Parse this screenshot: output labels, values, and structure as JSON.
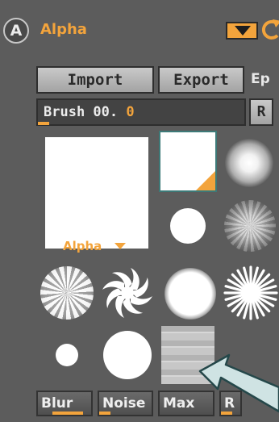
{
  "header": {
    "badge_letter": "A",
    "title": "Alpha"
  },
  "buttons": {
    "import_label": "Import",
    "export_label": "Export",
    "ep_label": "Ep"
  },
  "brush": {
    "label": "Brush 00.",
    "value": "0",
    "reset_label": "R"
  },
  "alpha": {
    "label": "Alpha",
    "thumbs": [
      "white-square",
      "white-square-selected",
      "soft-round",
      "small-hard-dot",
      "noise-round",
      "rough-splat",
      "swirl",
      "large-soft-circle",
      "starburst",
      "tiny-dot",
      "hard-circle",
      "stone-texture"
    ]
  },
  "tabs": {
    "blur_label": "Blur",
    "noise_label": "Noise",
    "max_label": "Max",
    "r_label": "R"
  },
  "colors": {
    "accent": "#f3a43c",
    "panel": "#5c5c5c",
    "button": "#b8b8b8"
  }
}
